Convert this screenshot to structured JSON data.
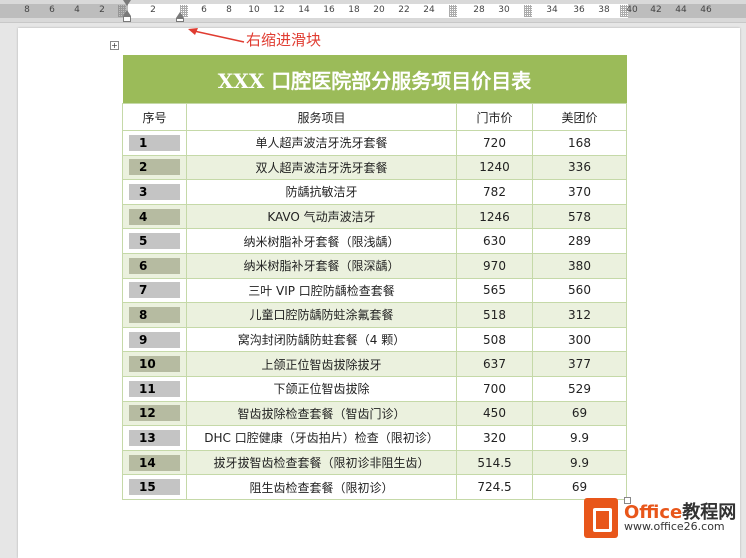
{
  "ruler": {
    "left_ticks": [
      "8",
      "6",
      "4",
      "2",
      "2"
    ],
    "right_ticks": [
      "6",
      "8",
      "10",
      "12",
      "14",
      "16",
      "18",
      "20",
      "22",
      "24",
      "28",
      "30",
      "34",
      "36",
      "38",
      "40",
      "42",
      "44",
      "46"
    ]
  },
  "annotation": {
    "text": "右缩进滑块",
    "color": "#e03c31"
  },
  "table": {
    "title": "XXX 口腔医院部分服务项目价目表",
    "headers": [
      "序号",
      "服务项目",
      "门市价",
      "美团价"
    ],
    "rows": [
      [
        "1",
        "单人超声波洁牙洗牙套餐",
        "720",
        "168"
      ],
      [
        "2",
        "双人超声波洁牙洗牙套餐",
        "1240",
        "336"
      ],
      [
        "3",
        "防龋抗敏洁牙",
        "782",
        "370"
      ],
      [
        "4",
        "KAVO 气动声波洁牙",
        "1246",
        "578"
      ],
      [
        "5",
        "纳米树脂补牙套餐（限浅龋）",
        "630",
        "289"
      ],
      [
        "6",
        "纳米树脂补牙套餐（限深龋）",
        "970",
        "380"
      ],
      [
        "7",
        "三叶 VIP 口腔防龋检查套餐",
        "565",
        "560"
      ],
      [
        "8",
        "儿童口腔防龋防蛀涂氟套餐",
        "518",
        "312"
      ],
      [
        "9",
        "窝沟封闭防龋防蛀套餐（4 颗）",
        "508",
        "300"
      ],
      [
        "10",
        "上颌正位智齿拔除拔牙",
        "637",
        "377"
      ],
      [
        "11",
        "下颌正位智齿拔除",
        "700",
        "529"
      ],
      [
        "12",
        "智齿拔除检查套餐（智齿门诊）",
        "450",
        "69"
      ],
      [
        "13",
        "DHC 口腔健康（牙齿拍片）检查（限初诊）",
        "320",
        "9.9"
      ],
      [
        "14",
        "拔牙拔智齿检查套餐（限初诊非阻生齿）",
        "514.5",
        "9.9"
      ],
      [
        "15",
        "阻生齿检查套餐（限初诊）",
        "724.5",
        "69"
      ]
    ],
    "colors": {
      "title_bg": "#9bbb59",
      "even_row_bg": "#ebf1de",
      "border": "#c5d9a8"
    }
  },
  "watermark": {
    "brand": "Office",
    "brand_cn": "教程网",
    "url": "www.office26.com"
  }
}
